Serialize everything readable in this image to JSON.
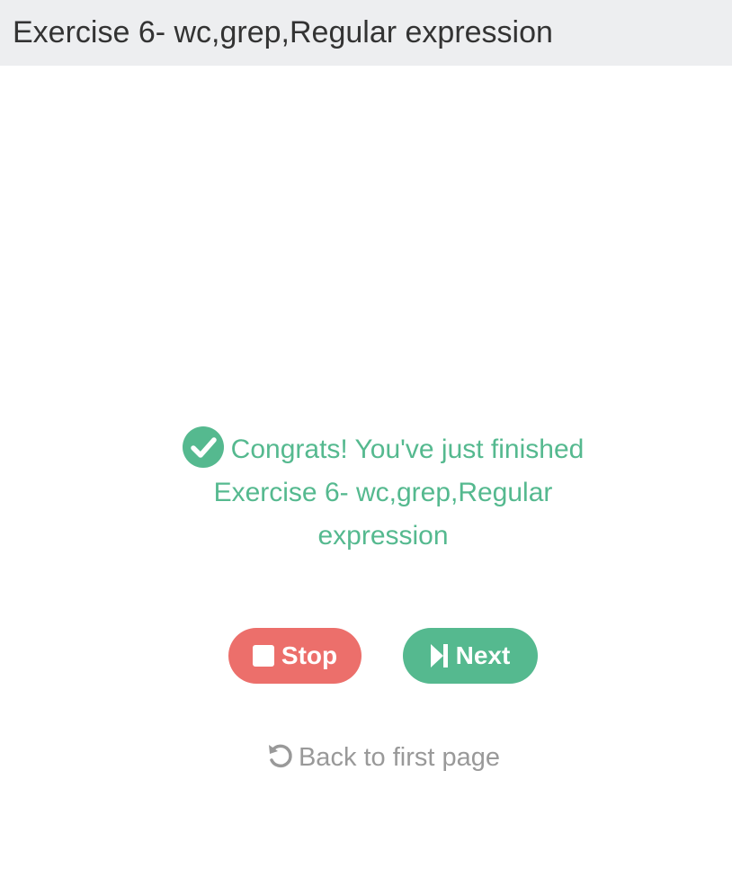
{
  "header": {
    "title": "Exercise 6- wc,grep,Regular expression"
  },
  "congrats": {
    "icon": "check-circle-icon",
    "line1": "Congrats! You've just finished",
    "line2": "Exercise 6- wc,grep,Regular",
    "line3": "expression"
  },
  "buttons": {
    "stop_label": "Stop",
    "stop_icon": "stop-square-icon",
    "next_label": "Next",
    "next_icon": "skip-next-icon"
  },
  "back": {
    "label": "Back to first page",
    "icon": "undo-icon"
  },
  "colors": {
    "header_bg": "#edeef0",
    "accent_green": "#55b98f",
    "stop_red": "#ec6f6b",
    "muted_gray": "#999999"
  }
}
